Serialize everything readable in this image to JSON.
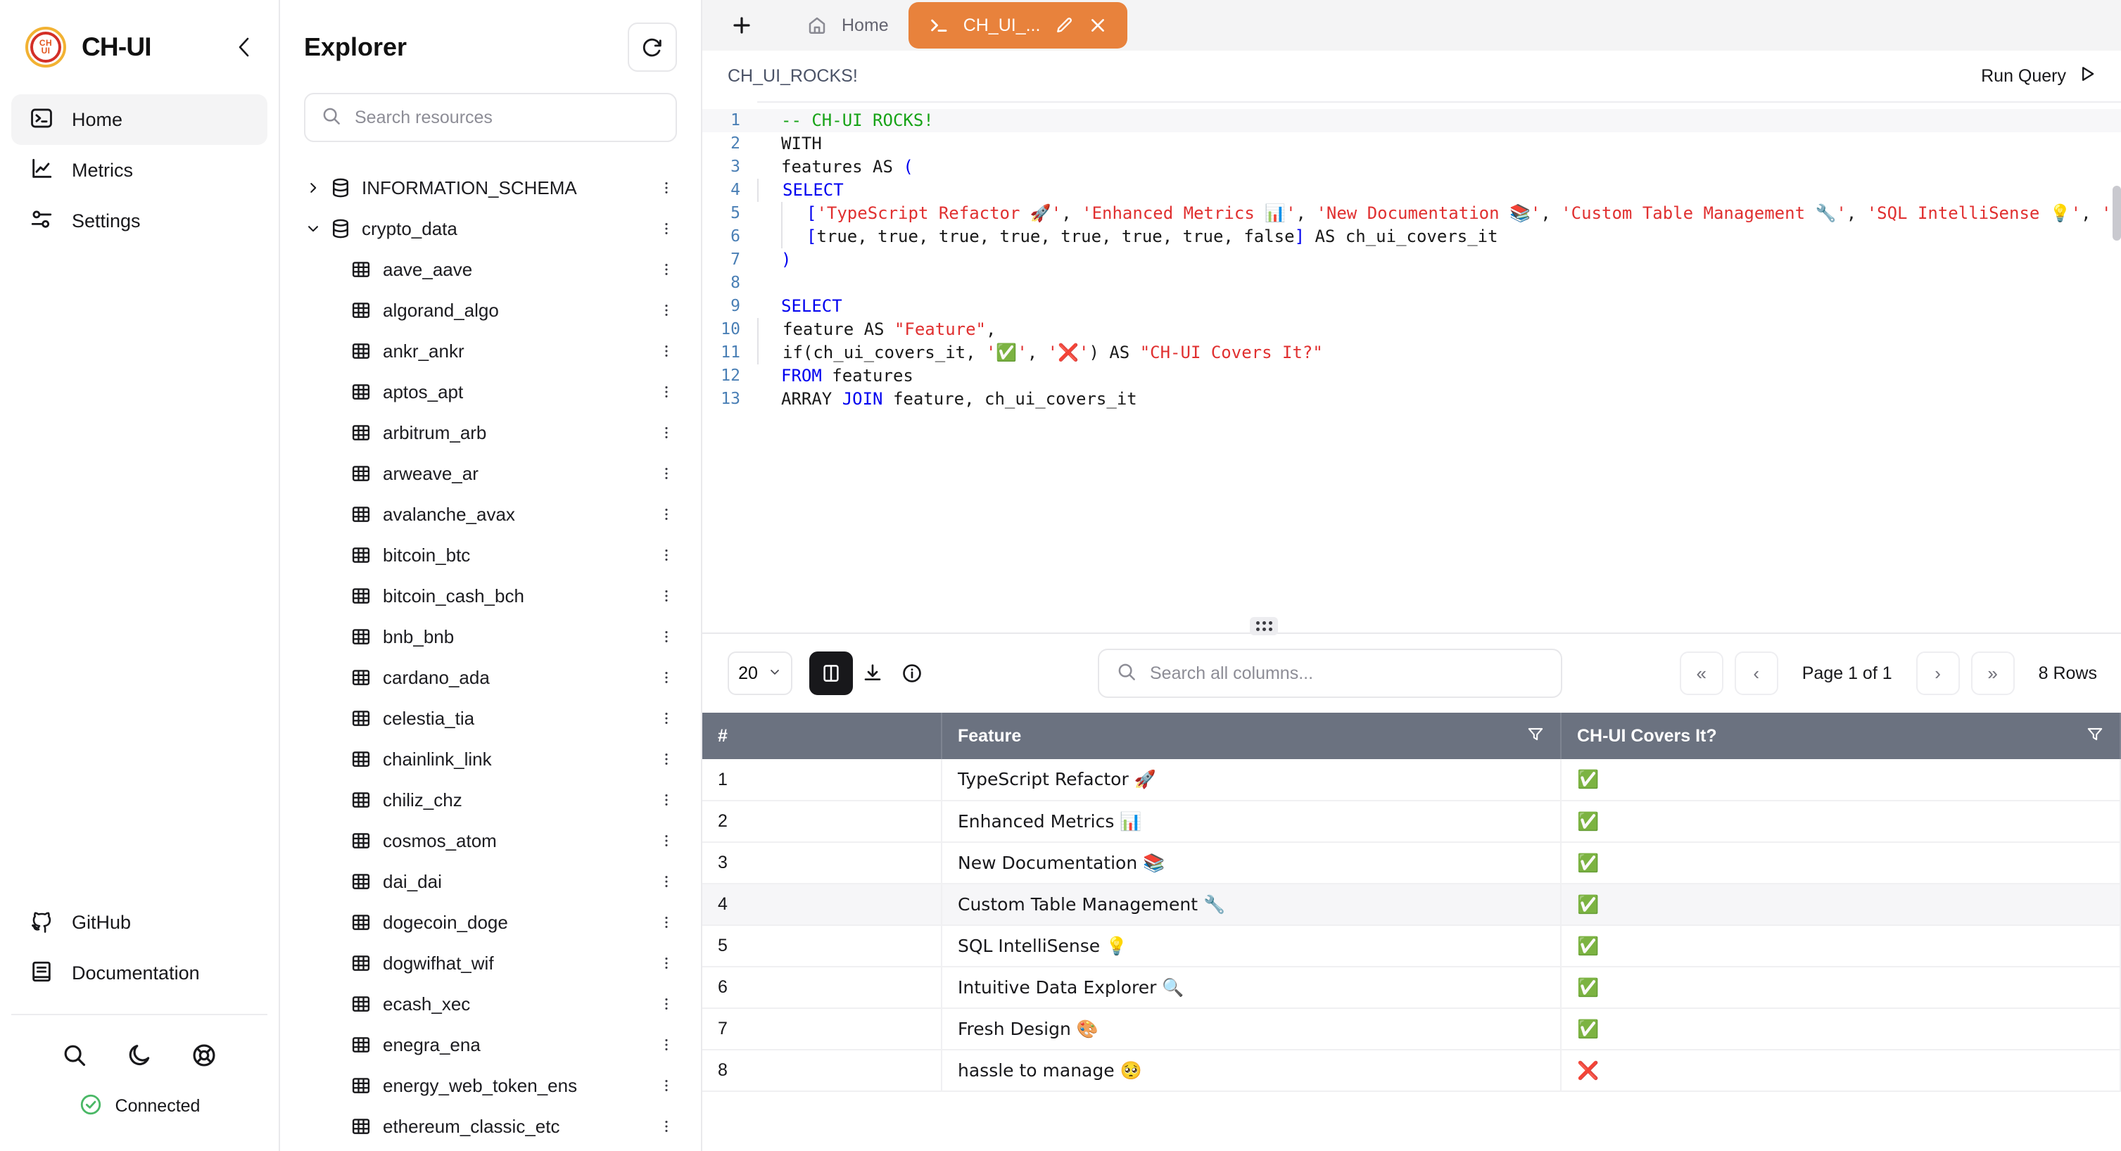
{
  "brand": {
    "name": "CH-UI",
    "logo_top": "CH",
    "logo_bottom": "UI"
  },
  "sidebar": {
    "items": [
      {
        "label": "Home",
        "icon": "terminal-icon",
        "active": true
      },
      {
        "label": "Metrics",
        "icon": "chart-line-icon",
        "active": false
      },
      {
        "label": "Settings",
        "icon": "sliders-icon",
        "active": false
      }
    ],
    "bottom_links": [
      {
        "label": "GitHub",
        "icon": "github-icon"
      },
      {
        "label": "Documentation",
        "icon": "book-icon"
      }
    ],
    "utility_icons": [
      "search-icon",
      "moon-icon",
      "lifebuoy-icon"
    ],
    "status": {
      "label": "Connected",
      "color": "#4ab866",
      "icon": "check-circle-icon"
    }
  },
  "explorer": {
    "title": "Explorer",
    "refresh_icon": "refresh-icon",
    "search": {
      "placeholder": "Search resources",
      "value": ""
    },
    "tree": [
      {
        "name": "INFORMATION_SCHEMA",
        "type": "database",
        "expanded": false
      },
      {
        "name": "crypto_data",
        "type": "database",
        "expanded": true
      },
      {
        "name": "aave_aave",
        "type": "table"
      },
      {
        "name": "algorand_algo",
        "type": "table"
      },
      {
        "name": "ankr_ankr",
        "type": "table"
      },
      {
        "name": "aptos_apt",
        "type": "table"
      },
      {
        "name": "arbitrum_arb",
        "type": "table"
      },
      {
        "name": "arweave_ar",
        "type": "table"
      },
      {
        "name": "avalanche_avax",
        "type": "table"
      },
      {
        "name": "bitcoin_btc",
        "type": "table"
      },
      {
        "name": "bitcoin_cash_bch",
        "type": "table"
      },
      {
        "name": "bnb_bnb",
        "type": "table"
      },
      {
        "name": "cardano_ada",
        "type": "table"
      },
      {
        "name": "celestia_tia",
        "type": "table"
      },
      {
        "name": "chainlink_link",
        "type": "table"
      },
      {
        "name": "chiliz_chz",
        "type": "table"
      },
      {
        "name": "cosmos_atom",
        "type": "table"
      },
      {
        "name": "dai_dai",
        "type": "table"
      },
      {
        "name": "dogecoin_doge",
        "type": "table"
      },
      {
        "name": "dogwifhat_wif",
        "type": "table"
      },
      {
        "name": "ecash_xec",
        "type": "table"
      },
      {
        "name": "enegra_ena",
        "type": "table"
      },
      {
        "name": "energy_web_token_ens",
        "type": "table"
      },
      {
        "name": "ethereum_classic_etc",
        "type": "table"
      }
    ]
  },
  "tabs": {
    "add_icon": "plus-icon",
    "items": [
      {
        "label": "Home",
        "icon": "home-icon",
        "active": false
      },
      {
        "label": "CH_UI_...",
        "icon": "terminal-icon",
        "active": true,
        "edit_icon": "pencil-icon",
        "close_icon": "close-icon"
      }
    ]
  },
  "query_header": {
    "name": "CH_UI_ROCKS!",
    "run_label": "Run Query",
    "run_icon": "play-icon"
  },
  "editor": {
    "lines": [
      {
        "n": 1,
        "indent": 0,
        "tokens": [
          {
            "t": "-- CH-UI ROCKS!",
            "c": "cm"
          }
        ],
        "highlight": true
      },
      {
        "n": 2,
        "indent": 0,
        "tokens": [
          {
            "t": "WITH",
            "c": "op"
          }
        ]
      },
      {
        "n": 3,
        "indent": 0,
        "tokens": [
          {
            "t": "features AS ",
            "c": "op"
          },
          {
            "t": "(",
            "c": "kw"
          }
        ]
      },
      {
        "n": 4,
        "indent": 1,
        "tokens": [
          {
            "t": "SELECT",
            "c": "kw"
          }
        ]
      },
      {
        "n": 5,
        "indent": 2,
        "tokens": [
          {
            "t": "[",
            "c": "kw"
          },
          {
            "t": "'TypeScript Refactor 🚀'",
            "c": "str"
          },
          {
            "t": ", ",
            "c": "op"
          },
          {
            "t": "'Enhanced Metrics 📊'",
            "c": "str"
          },
          {
            "t": ", ",
            "c": "op"
          },
          {
            "t": "'New Documentation 📚'",
            "c": "str"
          },
          {
            "t": ", ",
            "c": "op"
          },
          {
            "t": "'Custom Table Management 🔧'",
            "c": "str"
          },
          {
            "t": ", ",
            "c": "op"
          },
          {
            "t": "'SQL IntelliSense 💡'",
            "c": "str"
          },
          {
            "t": ", ",
            "c": "op"
          },
          {
            "t": "'Intuitive Da",
            "c": "str"
          }
        ]
      },
      {
        "n": 6,
        "indent": 2,
        "tokens": [
          {
            "t": "[",
            "c": "kw"
          },
          {
            "t": "true, true, true, true, true, true, true, false",
            "c": "op"
          },
          {
            "t": "]",
            "c": "kw"
          },
          {
            "t": " AS ch_ui_covers_it",
            "c": "op"
          }
        ]
      },
      {
        "n": 7,
        "indent": 0,
        "tokens": [
          {
            "t": ")",
            "c": "kw"
          }
        ]
      },
      {
        "n": 8,
        "indent": 0,
        "tokens": [
          {
            "t": "",
            "c": "op"
          }
        ]
      },
      {
        "n": 9,
        "indent": 0,
        "tokens": [
          {
            "t": "SELECT",
            "c": "kw"
          }
        ]
      },
      {
        "n": 10,
        "indent": 1,
        "tokens": [
          {
            "t": "feature AS ",
            "c": "op"
          },
          {
            "t": "\"Feature\"",
            "c": "str"
          },
          {
            "t": ",",
            "c": "op"
          }
        ]
      },
      {
        "n": 11,
        "indent": 1,
        "tokens": [
          {
            "t": "if(ch_ui_covers_it, ",
            "c": "op"
          },
          {
            "t": "'✅'",
            "c": "str"
          },
          {
            "t": ", ",
            "c": "op"
          },
          {
            "t": "'❌'",
            "c": "str"
          },
          {
            "t": ") AS ",
            "c": "op"
          },
          {
            "t": "\"CH-UI Covers It?\"",
            "c": "str"
          }
        ]
      },
      {
        "n": 12,
        "indent": 0,
        "tokens": [
          {
            "t": "FROM",
            "c": "kw"
          },
          {
            "t": " features",
            "c": "op"
          }
        ]
      },
      {
        "n": 13,
        "indent": 0,
        "tokens": [
          {
            "t": "ARRAY ",
            "c": "op"
          },
          {
            "t": "JOIN",
            "c": "kw"
          },
          {
            "t": " feature, ch_ui_covers_it",
            "c": "op"
          }
        ]
      }
    ]
  },
  "results": {
    "page_size": "20",
    "page_size_chevron": "chevron-down-icon",
    "columns_toggle_icon": "columns-icon",
    "download_icon": "download-icon",
    "info_icon": "info-icon",
    "search": {
      "placeholder": "Search all columns...",
      "value": ""
    },
    "pager": {
      "first_label": "«",
      "prev_label": "‹",
      "page_label": "Page 1 of 1",
      "next_label": "›",
      "last_label": "»",
      "rows_label": "8 Rows"
    },
    "headers": [
      {
        "label": "#",
        "filter": false
      },
      {
        "label": "Feature",
        "filter": true
      },
      {
        "label": "CH-UI Covers It?",
        "filter": true
      }
    ],
    "rows": [
      {
        "num": "1",
        "feature": "TypeScript Refactor 🚀",
        "covers": "✅",
        "alt": false
      },
      {
        "num": "2",
        "feature": "Enhanced Metrics 📊",
        "covers": "✅",
        "alt": false
      },
      {
        "num": "3",
        "feature": "New Documentation 📚",
        "covers": "✅",
        "alt": false
      },
      {
        "num": "4",
        "feature": "Custom Table Management 🔧",
        "covers": "✅",
        "alt": true
      },
      {
        "num": "5",
        "feature": "SQL IntelliSense 💡",
        "covers": "✅",
        "alt": false
      },
      {
        "num": "6",
        "feature": "Intuitive Data Explorer 🔍",
        "covers": "✅",
        "alt": false
      },
      {
        "num": "7",
        "feature": "Fresh Design 🎨",
        "covers": "✅",
        "alt": false
      },
      {
        "num": "8",
        "feature": "hassle to manage 🥺",
        "covers": "❌",
        "alt": false
      }
    ]
  },
  "colors": {
    "accent": "#e8823c",
    "header_bg": "#6b7280",
    "keyword": "#0000ef",
    "string": "#e03030",
    "comment": "#17a317",
    "status_green": "#4ab866"
  }
}
